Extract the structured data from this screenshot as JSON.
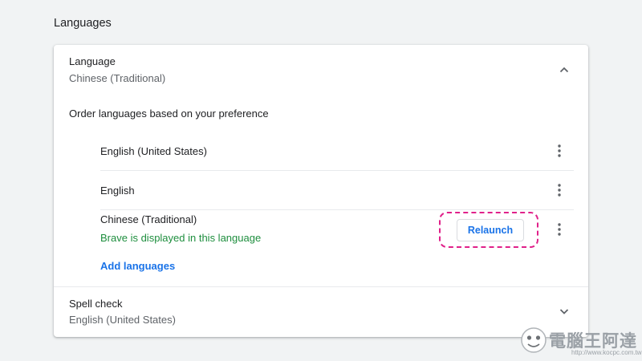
{
  "section": {
    "title": "Languages"
  },
  "language_card": {
    "title": "Language",
    "current": "Chinese (Traditional)",
    "order_label": "Order languages based on your preference",
    "languages": [
      {
        "name": "English (United States)"
      },
      {
        "name": "English"
      },
      {
        "name": "Chinese (Traditional)",
        "note": "Brave is displayed in this language",
        "relaunch_label": "Relaunch"
      }
    ],
    "add_languages_label": "Add languages"
  },
  "spell_check": {
    "title": "Spell check",
    "current": "English (United States)"
  },
  "icons": {
    "collapse": "chevron-up-icon",
    "expand": "chevron-down-icon",
    "more": "more-vert-icon"
  },
  "colors": {
    "accent": "#1a73e8",
    "success_note": "#1e8e3e",
    "highlight_dashed_box": "#e0218a"
  },
  "watermark": {
    "text": "電腦王阿達",
    "url": "http://www.kocpc.com.tw"
  }
}
